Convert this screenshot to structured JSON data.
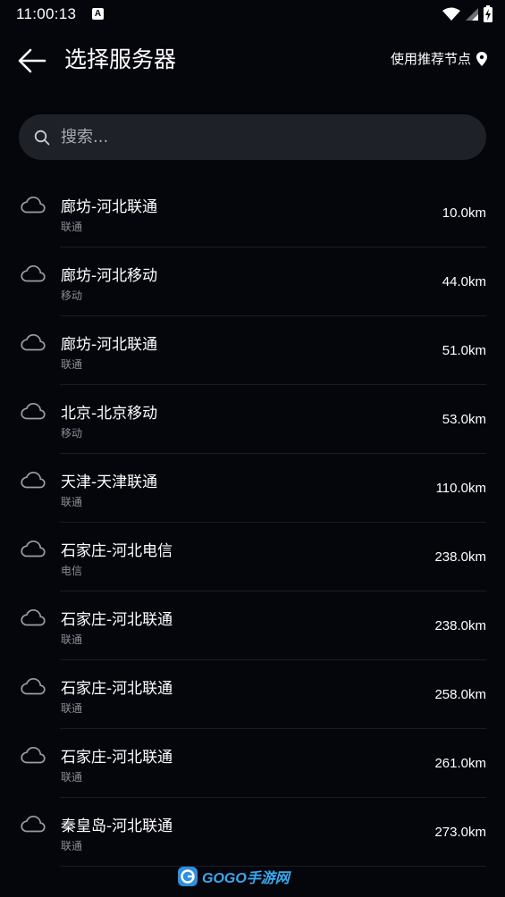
{
  "status_bar": {
    "time": "11:00:13",
    "notification_badge": "A"
  },
  "header": {
    "title": "选择服务器",
    "recommend_label": "使用推荐节点"
  },
  "search": {
    "placeholder": "搜索..."
  },
  "servers": [
    {
      "name": "廊坊-河北联通",
      "isp": "联通",
      "distance": "10.0km"
    },
    {
      "name": "廊坊-河北移动",
      "isp": "移动",
      "distance": "44.0km"
    },
    {
      "name": "廊坊-河北联通",
      "isp": "联通",
      "distance": "51.0km"
    },
    {
      "name": "北京-北京移动",
      "isp": "移动",
      "distance": "53.0km"
    },
    {
      "name": "天津-天津联通",
      "isp": "联通",
      "distance": "110.0km"
    },
    {
      "name": "石家庄-河北电信",
      "isp": "电信",
      "distance": "238.0km"
    },
    {
      "name": "石家庄-河北联通",
      "isp": "联通",
      "distance": "238.0km"
    },
    {
      "name": "石家庄-河北联通",
      "isp": "联通",
      "distance": "258.0km"
    },
    {
      "name": "石家庄-河北联通",
      "isp": "联通",
      "distance": "261.0km"
    },
    {
      "name": "秦皇岛-河北联通",
      "isp": "联通",
      "distance": "273.0km"
    }
  ],
  "watermark": {
    "text": "GOGO手游网"
  },
  "colors": {
    "background": "#05060c",
    "search_background": "#1f2128",
    "secondary_text": "#8b8e96",
    "icon_gray": "#9a9da5"
  }
}
